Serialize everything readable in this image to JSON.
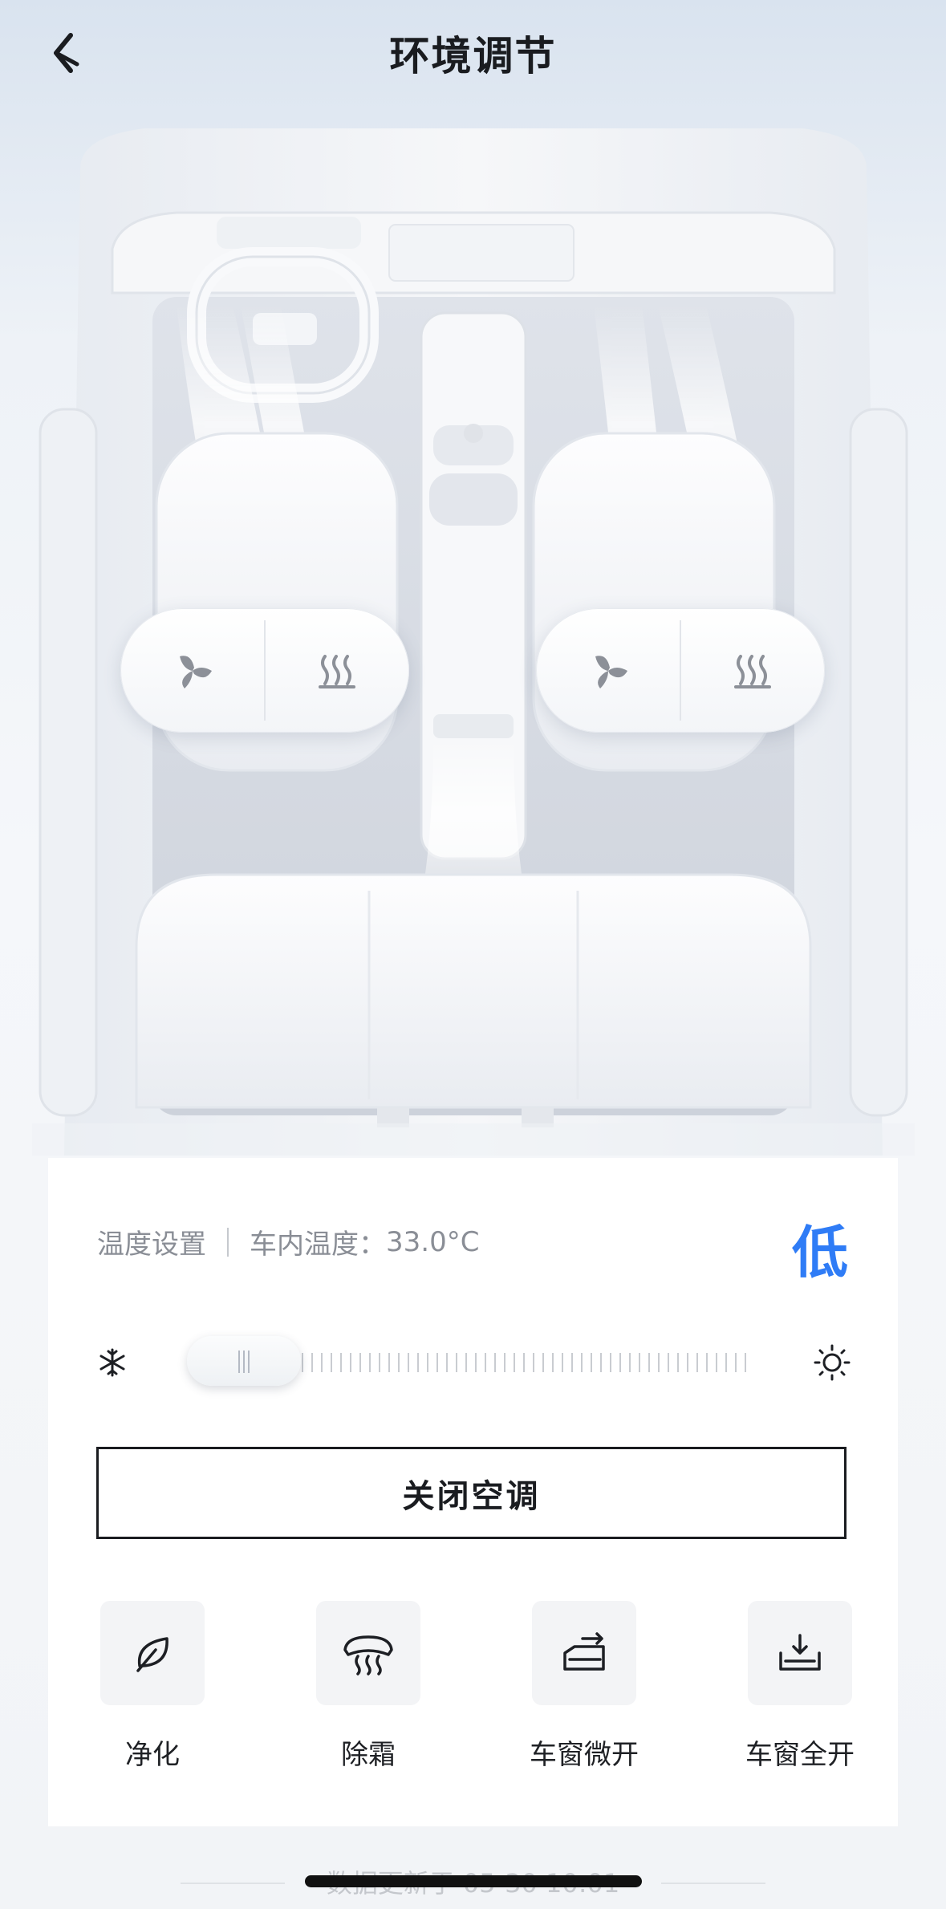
{
  "header": {
    "title": "环境调节"
  },
  "temperature": {
    "label": "温度设置",
    "cabin_label": "车内温度：",
    "cabin_value": "33.0°C",
    "level": "低",
    "slider_position": 0.08
  },
  "ac_button": {
    "label": "关闭空调"
  },
  "functions": [
    {
      "label": "净化",
      "icon": "leaf-icon"
    },
    {
      "label": "除霜",
      "icon": "defrost-icon"
    },
    {
      "label": "车窗微开",
      "icon": "window-vent-icon"
    },
    {
      "label": "车窗全开",
      "icon": "window-open-icon"
    }
  ],
  "footer": {
    "update_text": "数据更新于 05-30 10:01"
  },
  "colors": {
    "accent": "#2f7cf6",
    "text": "#1a1c20",
    "muted": "#8a8e96"
  }
}
